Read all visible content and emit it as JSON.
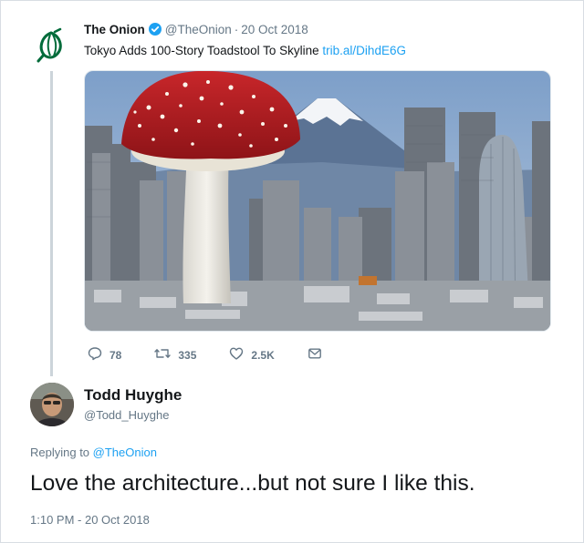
{
  "tweet": {
    "author_name": "The Onion",
    "author_handle": "@TheOnion",
    "separator": "·",
    "date": "20 Oct 2018",
    "text": "Tokyo Adds 100-Story Toadstool To Skyline",
    "link": "trib.al/DihdE6G",
    "verified": true,
    "actions": {
      "replies": "78",
      "retweets": "335",
      "likes": "2.5K"
    }
  },
  "reply": {
    "author_name": "Todd Huyghe",
    "author_handle": "@Todd_Huyghe",
    "replying_prefix": "Replying to",
    "replying_to": "@TheOnion",
    "text": "Love the architecture...but not sure I like this.",
    "timestamp": "1:10 PM - 20 Oct 2018"
  },
  "colors": {
    "link": "#1da1f2",
    "onion_green": "#006b3a",
    "muted": "#657786"
  },
  "icons": [
    "onion-logo-icon",
    "verified-badge-icon",
    "reply-icon",
    "retweet-icon",
    "like-icon",
    "dm-icon"
  ]
}
